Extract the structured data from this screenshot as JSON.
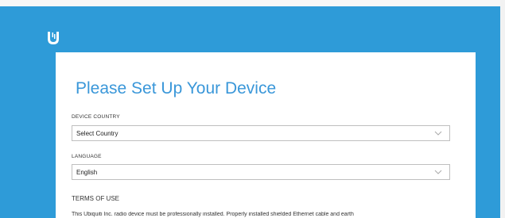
{
  "brand": {
    "logo_icon": "ubiquiti-u-logo-icon"
  },
  "setup": {
    "title": "Please Set Up Your Device",
    "country_label": "DEVICE COUNTRY",
    "country_value": "Select Country",
    "language_label": "LANGUAGE",
    "language_value": "English",
    "terms_heading": "TERMS OF USE",
    "terms_text": "This Ubiquiti Inc. radio device must be professionally installed. Properly installed shielded Ethernet cable and earth"
  },
  "colors": {
    "background": "#2e9bd8",
    "title": "#3a97d9",
    "card": "#ffffff"
  }
}
